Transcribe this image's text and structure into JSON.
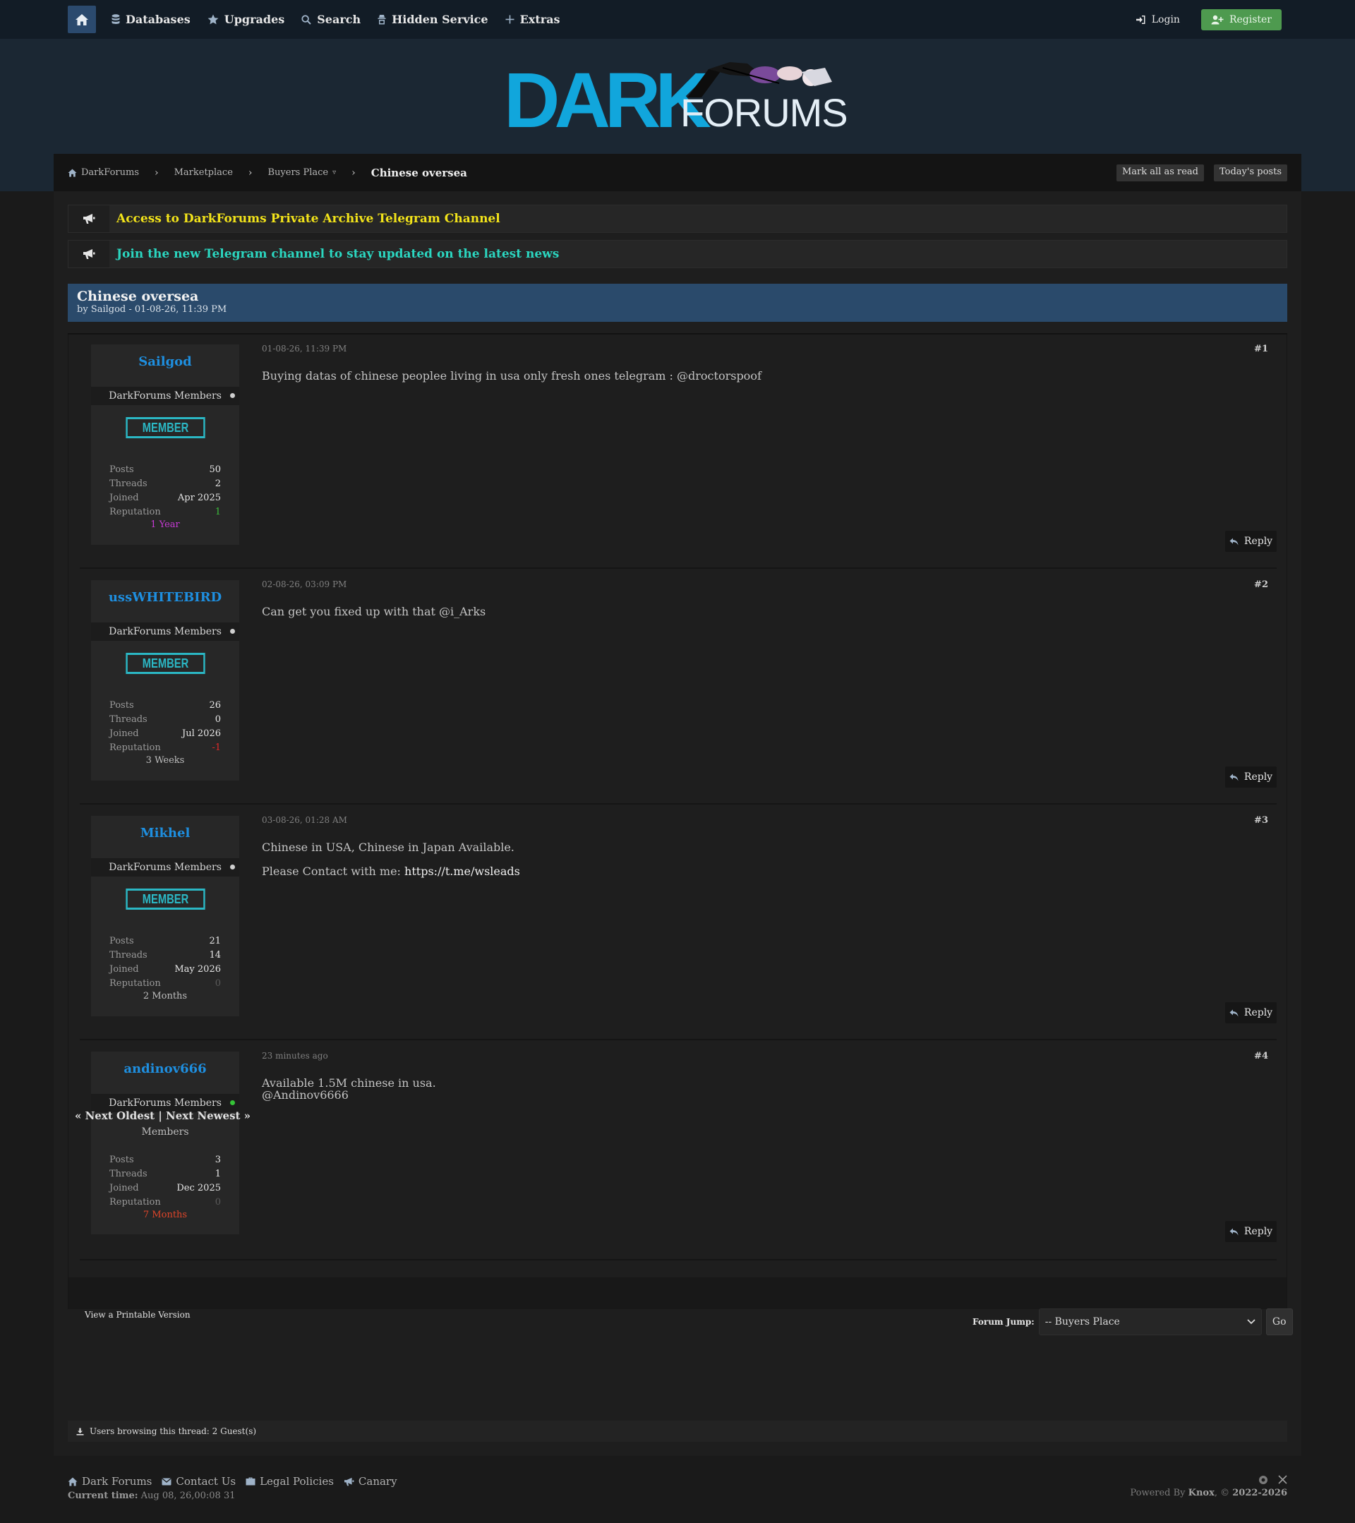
{
  "nav": {
    "items": [
      {
        "label": "Databases",
        "icon": "database-icon"
      },
      {
        "label": "Upgrades",
        "icon": "star-icon"
      },
      {
        "label": "Search",
        "icon": "search-icon"
      },
      {
        "label": "Hidden Service",
        "icon": "incognito-icon"
      },
      {
        "label": "Extras",
        "icon": "plus-icon"
      }
    ],
    "login": "Login",
    "register": "Register"
  },
  "logo": {
    "dark": "DARK",
    "forums": "FORUMS"
  },
  "breadcrumb": {
    "items": [
      "DarkForums",
      "Marketplace",
      "Buyers Place"
    ],
    "current": "Chinese oversea",
    "mark_all_read": "Mark all as read",
    "todays_posts": "Today's posts"
  },
  "announcements": [
    {
      "text": "Access to DarkForums Private Archive Telegram Channel",
      "color": "#f2e31a"
    },
    {
      "text": "Join the new Telegram channel to stay updated on the latest news",
      "color": "#2bd6c0"
    }
  ],
  "thread": {
    "title": "Chinese oversea",
    "meta": "by Sailgod - 01-08-26, 11:39 PM"
  },
  "posts": [
    {
      "username": "Sailgod",
      "group": "DarkForums Members",
      "badge": "MEMBER",
      "online": false,
      "stats": {
        "posts": "50",
        "threads": "2",
        "joined": "Apr 2025",
        "reputation": "1"
      },
      "rep_color": "#3cbd3c",
      "tenure": "1 Year",
      "tenure_color": "#c83ad6",
      "date": "01-08-26, 11:39 PM",
      "number": "#1",
      "body": [
        "Buying datas of chinese peoplee living in usa only fresh ones telegram : @droctorspoof"
      ],
      "reply": "Reply"
    },
    {
      "username": "ussWHITEBIRD",
      "group": "DarkForums Members",
      "badge": "MEMBER",
      "online": false,
      "stats": {
        "posts": "26",
        "threads": "0",
        "joined": "Jul 2026",
        "reputation": "-1"
      },
      "rep_color": "#e02828",
      "tenure": "3 Weeks",
      "tenure_color": "#bdbdbd",
      "date": "02-08-26, 03:09 PM",
      "number": "#2",
      "body": [
        "Can get you fixed up with that @i_Arks"
      ],
      "reply": "Reply"
    },
    {
      "username": "Mikhel",
      "group": "DarkForums Members",
      "badge": "MEMBER",
      "online": false,
      "stats": {
        "posts": "21",
        "threads": "14",
        "joined": "May 2026",
        "reputation": "0"
      },
      "rep_color": "#5a5a5a",
      "tenure": "2 Months",
      "tenure_color": "#bdbdbd",
      "date": "03-08-26, 01:28 AM",
      "number": "#3",
      "body": [
        "Chinese in USA, Chinese in Japan Available."
      ],
      "contact_prefix": "Please Contact with me: ",
      "contact_link": "https://t.me/wsleads",
      "reply": "Reply"
    },
    {
      "username": "andinov666",
      "group": "DarkForums Members",
      "badge": "",
      "members_text": "Members",
      "online": true,
      "stats": {
        "posts": "3",
        "threads": "1",
        "joined": "Dec 2025",
        "reputation": "0"
      },
      "rep_color": "#5a5a5a",
      "tenure": "7 Months",
      "tenure_color": "#e0452a",
      "date": "23 minutes ago",
      "number": "#4",
      "body": [
        "Available 1.5M chinese in usa.",
        "@Andinov6666"
      ],
      "reply": "Reply"
    }
  ],
  "stat_labels": {
    "posts": "Posts",
    "threads": "Threads",
    "joined": "Joined",
    "reputation": "Reputation"
  },
  "thread_nav": "« Next Oldest | Next Newest »",
  "printable": "View a Printable Version",
  "forum_jump": {
    "label": "Forum Jump:",
    "selected": "-- Buyers Place",
    "go": "Go"
  },
  "browsing": "Users browsing this thread: 2 Guest(s)",
  "footer": {
    "links": [
      {
        "label": "Dark Forums",
        "icon": "home-icon"
      },
      {
        "label": "Contact Us",
        "icon": "envelope-icon"
      },
      {
        "label": "Legal Policies",
        "icon": "briefcase-icon"
      },
      {
        "label": "Canary",
        "icon": "megaphone-icon"
      }
    ],
    "current_time_label": "Current time:",
    "current_time": "Aug 08, 26,00:08 31",
    "powered_prefix": "Powered By ",
    "powered_name": "Knox",
    "powered_suffix": ", © ",
    "years": "2022-2026"
  }
}
